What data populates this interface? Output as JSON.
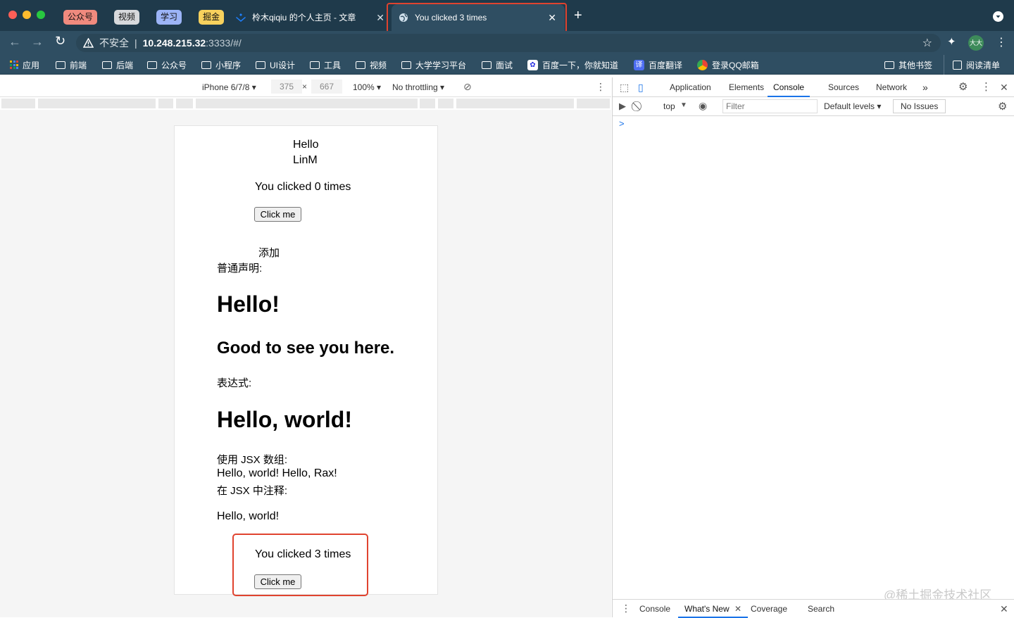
{
  "browser": {
    "tab_groups": [
      "公众号",
      "视频",
      "学习",
      "掘金"
    ],
    "tab_group_colors": [
      "#f08a7e",
      "#d7d9dc",
      "#9cb4f7",
      "#f7d15d"
    ],
    "inactive_tab_title": "柃木qiqiu 的个人主页 - 文章",
    "active_tab_title": "You clicked 3 times",
    "security_label": "不安全",
    "url_host": "10.248.215.32",
    "url_rest": ":3333/#/",
    "profile_initials": "大大",
    "bookmarks": [
      "应用",
      "前端",
      "后端",
      "公众号",
      "小程序",
      "UI设计",
      "工具",
      "视频",
      "大学学习平台",
      "面试",
      "百度一下，你就知道",
      "百度翻译",
      "登录QQ邮箱"
    ],
    "bookmarks_right": [
      "其他书签",
      "阅读清单"
    ]
  },
  "device_toolbar": {
    "device": "iPhone 6/7/8 ▾",
    "width": "375",
    "height": "667",
    "zoom": "100% ▾",
    "throttling": "No throttling ▾"
  },
  "page": {
    "hello": "Hello",
    "name": "LinM",
    "counter1_text": "You clicked 0 times",
    "click_me": "Click me",
    "add": "添加",
    "normal_decl": "普通声明:",
    "h1_hello": "Hello!",
    "h2_good": "Good to see you here.",
    "expression": "表达式:",
    "h1_world": "Hello, world!",
    "jsx_array": "使用 JSX 数组:",
    "jsx_array_value": "Hello, world! Hello, Rax!",
    "jsx_comment": "在 JSX 中注释:",
    "hello_world": "Hello, world!",
    "counter2_text": "You clicked 3 times",
    "click_me2": "Click me"
  },
  "devtools": {
    "tabs": [
      "Application",
      "Elements",
      "Console",
      "Sources",
      "Network"
    ],
    "active_tab": "Console",
    "context": "top",
    "filter_placeholder": "Filter",
    "levels": "Default levels ▾",
    "issues": "No Issues",
    "prompt": ">",
    "drawer_tabs": [
      "Console",
      "What's New",
      "Coverage",
      "Search"
    ]
  },
  "watermark": "@稀土掘金技术社区"
}
